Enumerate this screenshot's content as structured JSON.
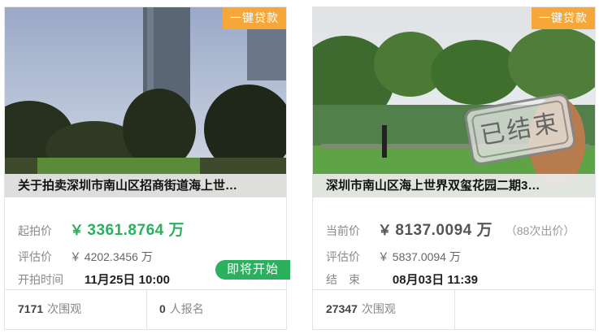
{
  "cards": [
    {
      "badge": "一键贷款",
      "title": "关于拍卖深圳市南山区招商街道海上世…",
      "price_label": "起拍价",
      "price_symbol": "￥",
      "price_value": "3361.8764 万",
      "appraisal_label": "评估价",
      "appraisal_value": "￥ 4202.3456 万",
      "time_label": "开拍时间",
      "time_value": "11月25日 10:00",
      "status": "即将开始",
      "views_count": "7171",
      "views_label": "次围观",
      "signup_count": "0",
      "signup_label": "人报名"
    },
    {
      "badge": "一键贷款",
      "title": "深圳市南山区海上世界双玺花园二期3…",
      "price_label": "当前价",
      "price_symbol": "￥",
      "price_value": "8137.0094 万",
      "bids": "（88次出价）",
      "appraisal_label": "评估价",
      "appraisal_value": "￥ 5837.0094 万",
      "time_label": "结　束",
      "time_value": "08月03日 11:39",
      "stamp": "已结束",
      "views_count": "27347",
      "views_label": "次围观"
    }
  ]
}
